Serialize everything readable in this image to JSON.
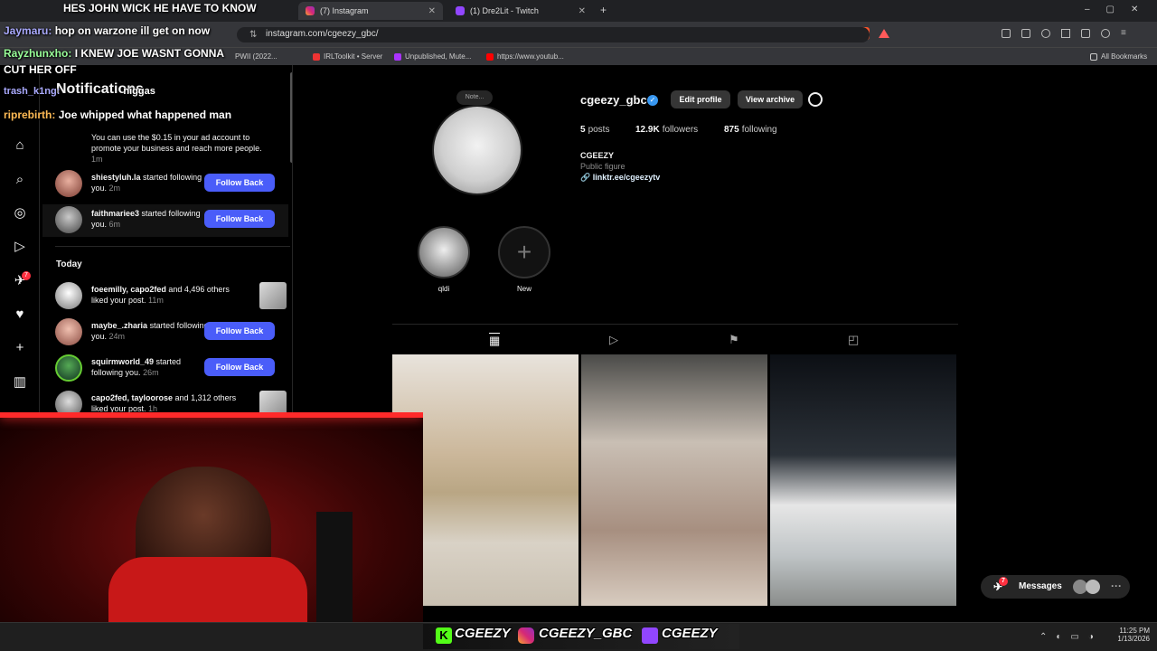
{
  "browser": {
    "tabs": [
      {
        "label": "(7) Instagram",
        "active": true
      },
      {
        "label": "(1) Dre2Lit - Twitch",
        "active": false
      }
    ],
    "new_tab_label": "+",
    "url": "instagram.com/cgeezy_gbc/",
    "bookmarks": [
      "IRLToolkit • Server",
      "Unpublished, Mute...",
      "https://www.youtub...",
      "All Bookmarks"
    ],
    "bookmark_partial": "PWII (2022..."
  },
  "chat": {
    "lines": [
      {
        "user": "",
        "msg": "HES JOHN WICK HE HAVE TO KNOW"
      },
      {
        "user": "Jaymaru:",
        "msg": "hop on warzone ill get on now"
      },
      {
        "user": "Rayzhunxho:",
        "msg": "I KNEW JOE WASNT GONNA"
      },
      {
        "user": "",
        "msg": "CUT HER OFF"
      },
      {
        "user": "trash_k1ng:",
        "msg": "Notifications"
      },
      {
        "user": "riprebirth:",
        "msg": "Joe whipped what happened man"
      }
    ],
    "fragment": "niggas"
  },
  "notifications": {
    "title": "Notifications",
    "ad_text": "You can use the $0.15 in your ad account to promote your business and reach more people.",
    "ad_time": "1m",
    "items_top": [
      {
        "user": "shiestyluh.la",
        "action": "started following you.",
        "time": "2m",
        "button": "Follow Back"
      },
      {
        "user": "faithmariee3",
        "action": "started following you.",
        "time": "6m",
        "button": "Follow Back"
      }
    ],
    "section_today": "Today",
    "items_today": [
      {
        "user": "foeemilly, capo2fed",
        "action": "and 4,496 others liked your post.",
        "time": "11m"
      },
      {
        "user": "maybe_.zharia",
        "action": "started following you.",
        "time": "24m",
        "button": "Follow Back"
      },
      {
        "user": "squirmworld_49",
        "action": "started following you.",
        "time": "26m",
        "button": "Follow Back"
      },
      {
        "user": "capo2fed, tayloorose",
        "action": "and 1,312 others liked your post.",
        "time": "1h"
      }
    ]
  },
  "profile": {
    "note": "Note...",
    "username": "cgeezy_gbc",
    "edit_button": "Edit profile",
    "archive_button": "View archive",
    "posts_count": "5",
    "posts_label": "posts",
    "followers_count": "12.9K",
    "followers_label": "followers",
    "following_count": "875",
    "following_label": "following",
    "display_name": "CGEEZY",
    "category": "Public figure",
    "link": "linktr.ee/cgeezytv",
    "highlights": [
      {
        "label": "qldi"
      },
      {
        "label": "New"
      }
    ]
  },
  "messages": {
    "label": "Messages",
    "badge": "7"
  },
  "nav_badge": "7",
  "overlay": {
    "kick": "CGEEZY",
    "instagram": "CGEEZY_GBC",
    "twitch": "CGEEZY"
  },
  "taskbar": {
    "time": "11:25 PM",
    "date": "1/13/2026"
  },
  "colors": {
    "follow_button": "#4a5df9",
    "verified": "#3897f0",
    "badge": "#ff3040",
    "cam_red": "#7a1010"
  }
}
